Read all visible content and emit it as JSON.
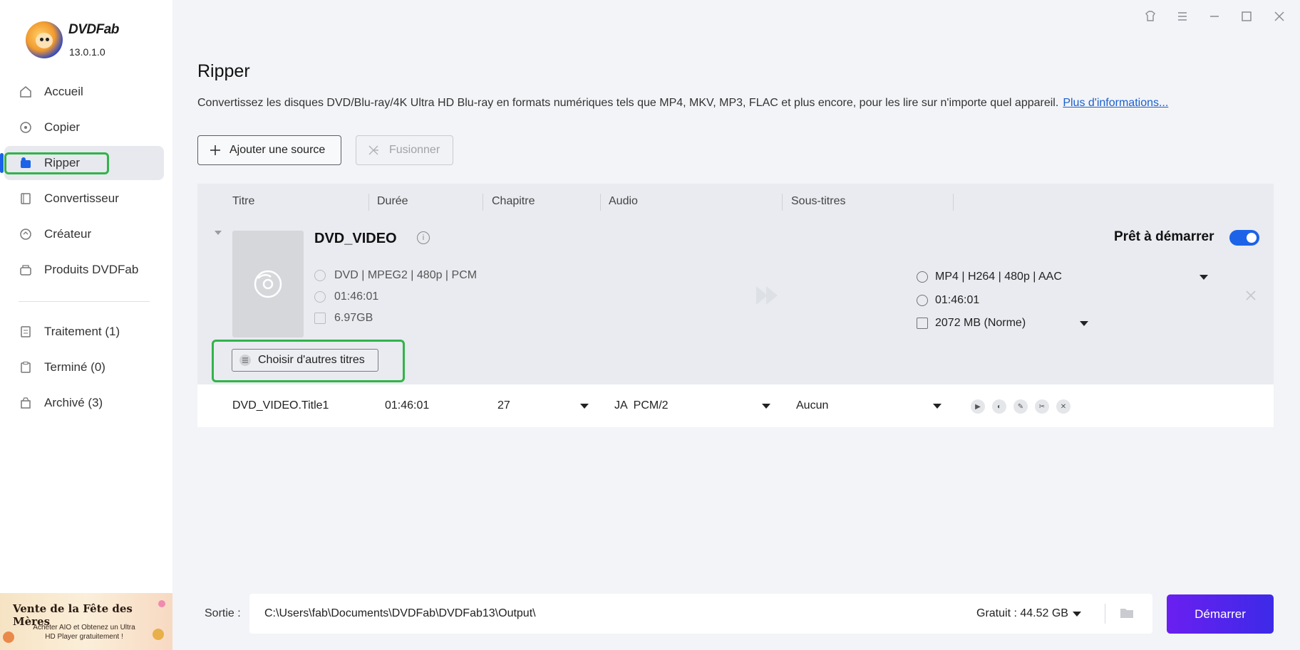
{
  "app": {
    "brand": "DVDFab",
    "version": "13.0.1.0"
  },
  "sidebar": {
    "items": [
      {
        "label": "Accueil",
        "icon": "home-icon"
      },
      {
        "label": "Copier",
        "icon": "copy-icon"
      },
      {
        "label": "Ripper",
        "icon": "ripper-icon",
        "active": true
      },
      {
        "label": "Convertisseur",
        "icon": "converter-icon"
      },
      {
        "label": "Créateur",
        "icon": "creator-icon"
      },
      {
        "label": "Produits DVDFab",
        "icon": "products-icon"
      }
    ],
    "queue": [
      {
        "label": "Traitement (1)",
        "icon": "processing-icon"
      },
      {
        "label": "Terminé (0)",
        "icon": "finished-icon"
      },
      {
        "label": "Archivé (3)",
        "icon": "archived-icon"
      }
    ],
    "promo": {
      "title": "Vente de la Fête des Mères",
      "text": "Acheter AIO et Obtenez un Ultra HD Player gratuitement !"
    }
  },
  "main": {
    "title": "Ripper",
    "description": "Convertissez les disques DVD/Blu-ray/4K Ultra HD Blu-ray en formats numériques tels que MP4, MKV, MP3, FLAC et plus encore, pour les lire sur n'importe quel appareil.",
    "more_link": "Plus d'informations...",
    "add_source": "Ajouter une source",
    "merge": "Fusionner"
  },
  "table": {
    "headers": [
      "Titre",
      "Durée",
      "Chapitre",
      "Audio",
      "Sous-titres"
    ],
    "source": {
      "name": "DVD_VIDEO",
      "info": "DVD | MPEG2 | 480p | PCM",
      "duration": "01:46:01",
      "size": "6.97GB",
      "choose_titles": "Choisir d'autres titres"
    },
    "output": {
      "status": "Prêt à démarrer",
      "profile": "MP4 | H264 | 480p | AAC",
      "duration": "01:46:01",
      "size": "2072 MB (Norme)"
    },
    "title_row": {
      "name": "DVD_VIDEO.Title1",
      "duration": "01:46:01",
      "chapters": "27",
      "audio": "JA  PCM/2",
      "subtitles": "Aucun"
    }
  },
  "footer": {
    "output_label": "Sortie :",
    "output_path": "C:\\Users\\fab\\Documents\\DVDFab\\DVDFab13\\Output\\",
    "free_space": "Gratuit : 44.52 GB",
    "start": "Démarrer"
  }
}
